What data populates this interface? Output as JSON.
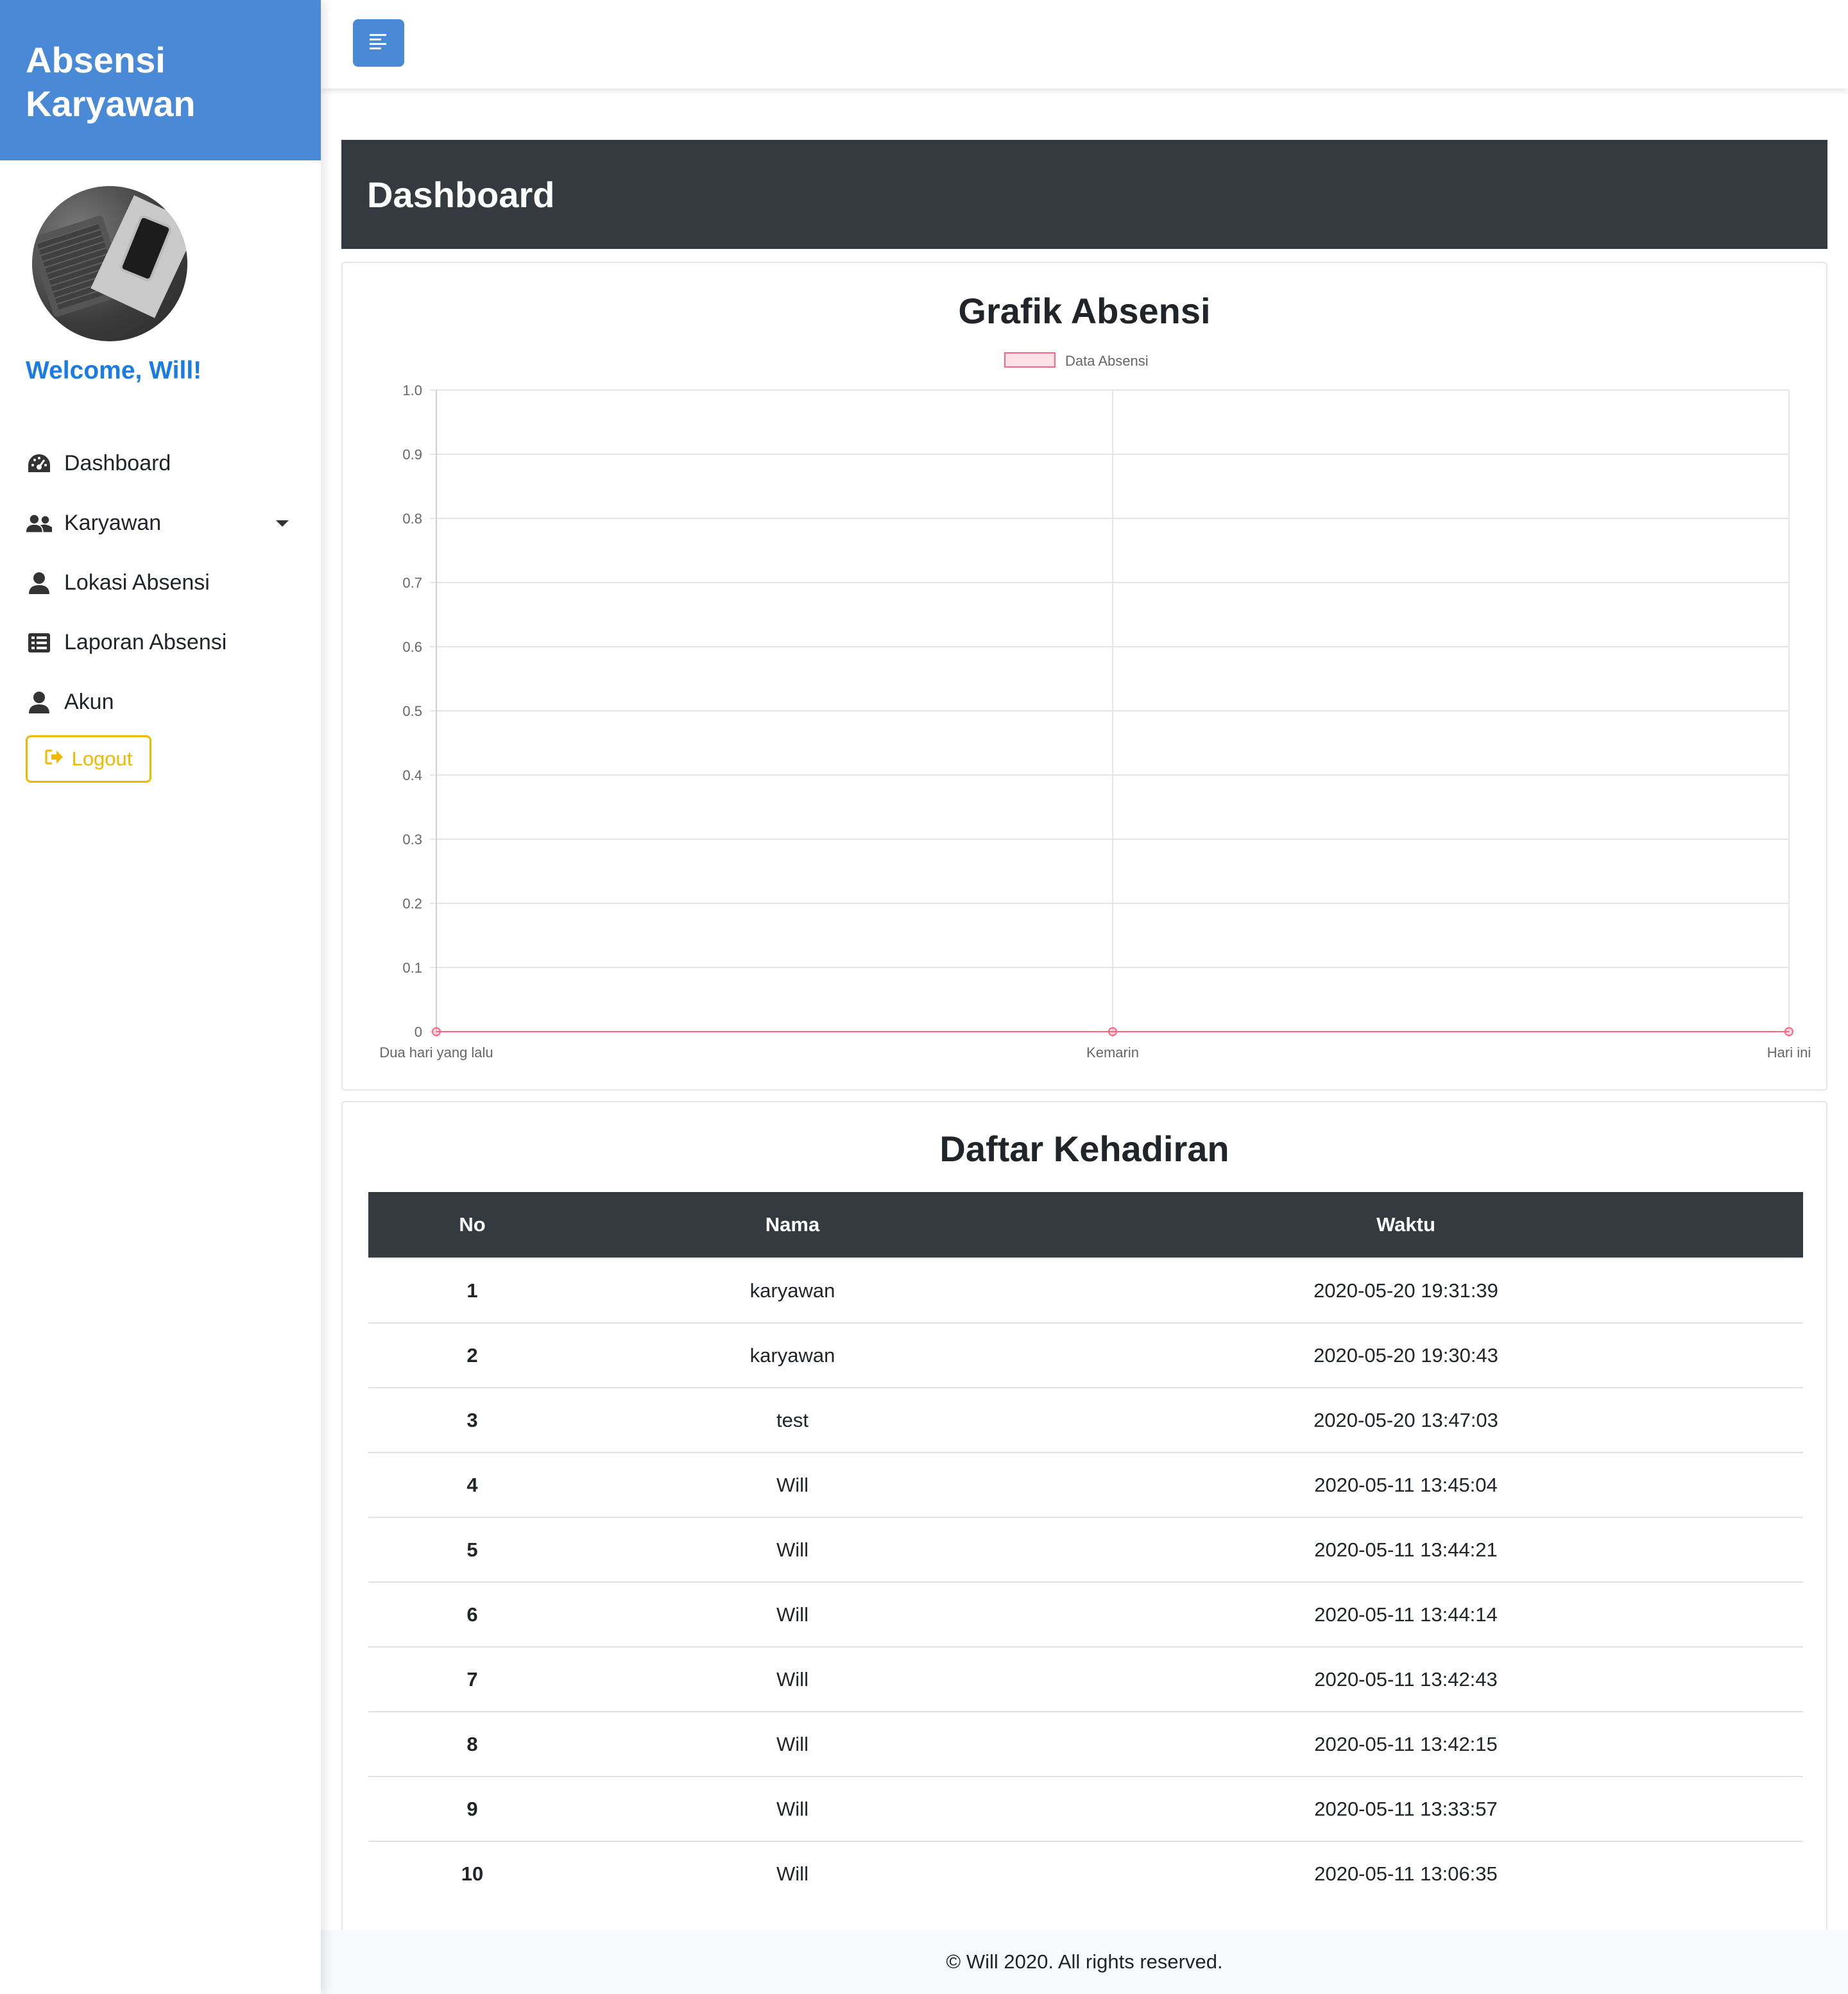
{
  "sidebar": {
    "brand_line1": "Absensi",
    "brand_line2": "Karyawan",
    "welcome": "Welcome, Will!",
    "items": [
      {
        "label": "Dashboard",
        "icon": "tachometer-icon"
      },
      {
        "label": "Karyawan",
        "icon": "users-icon"
      },
      {
        "label": "Lokasi Absensi",
        "icon": "user-icon"
      },
      {
        "label": "Laporan Absensi",
        "icon": "list-icon"
      },
      {
        "label": "Akun",
        "icon": "user-icon"
      }
    ],
    "logout_label": "Logout"
  },
  "header": {
    "title": "Dashboard"
  },
  "chart_card": {
    "title": "Grafik Absensi"
  },
  "chart_data": {
    "type": "line",
    "title": "Grafik Absensi",
    "categories": [
      "Dua hari yang lalu",
      "Kemarin",
      "Hari ini"
    ],
    "series": [
      {
        "name": "Data Absensi",
        "values": [
          0,
          0,
          0
        ]
      }
    ],
    "ylim": [
      0,
      1.0
    ],
    "yticks": [
      "0",
      "0.1",
      "0.2",
      "0.3",
      "0.4",
      "0.5",
      "0.6",
      "0.7",
      "0.8",
      "0.9",
      "1.0"
    ],
    "grid": true,
    "legend": "top-center",
    "color": "#ff6384"
  },
  "table_card": {
    "title": "Daftar Kehadiran",
    "columns": [
      "No",
      "Nama",
      "Waktu"
    ],
    "rows": [
      [
        "1",
        "karyawan",
        "2020-05-20 19:31:39"
      ],
      [
        "2",
        "karyawan",
        "2020-05-20 19:30:43"
      ],
      [
        "3",
        "test",
        "2020-05-20 13:47:03"
      ],
      [
        "4",
        "Will",
        "2020-05-11 13:45:04"
      ],
      [
        "5",
        "Will",
        "2020-05-11 13:44:21"
      ],
      [
        "6",
        "Will",
        "2020-05-11 13:44:14"
      ],
      [
        "7",
        "Will",
        "2020-05-11 13:42:43"
      ],
      [
        "8",
        "Will",
        "2020-05-11 13:42:15"
      ],
      [
        "9",
        "Will",
        "2020-05-11 13:33:57"
      ],
      [
        "10",
        "Will",
        "2020-05-11 13:06:35"
      ]
    ]
  },
  "footer": {
    "text": "© Will 2020. All rights reserved."
  },
  "colors": {
    "brand": "#4a89d6",
    "dark": "#343a40",
    "welcome": "#1a7be0",
    "logout": "#f0b800"
  }
}
